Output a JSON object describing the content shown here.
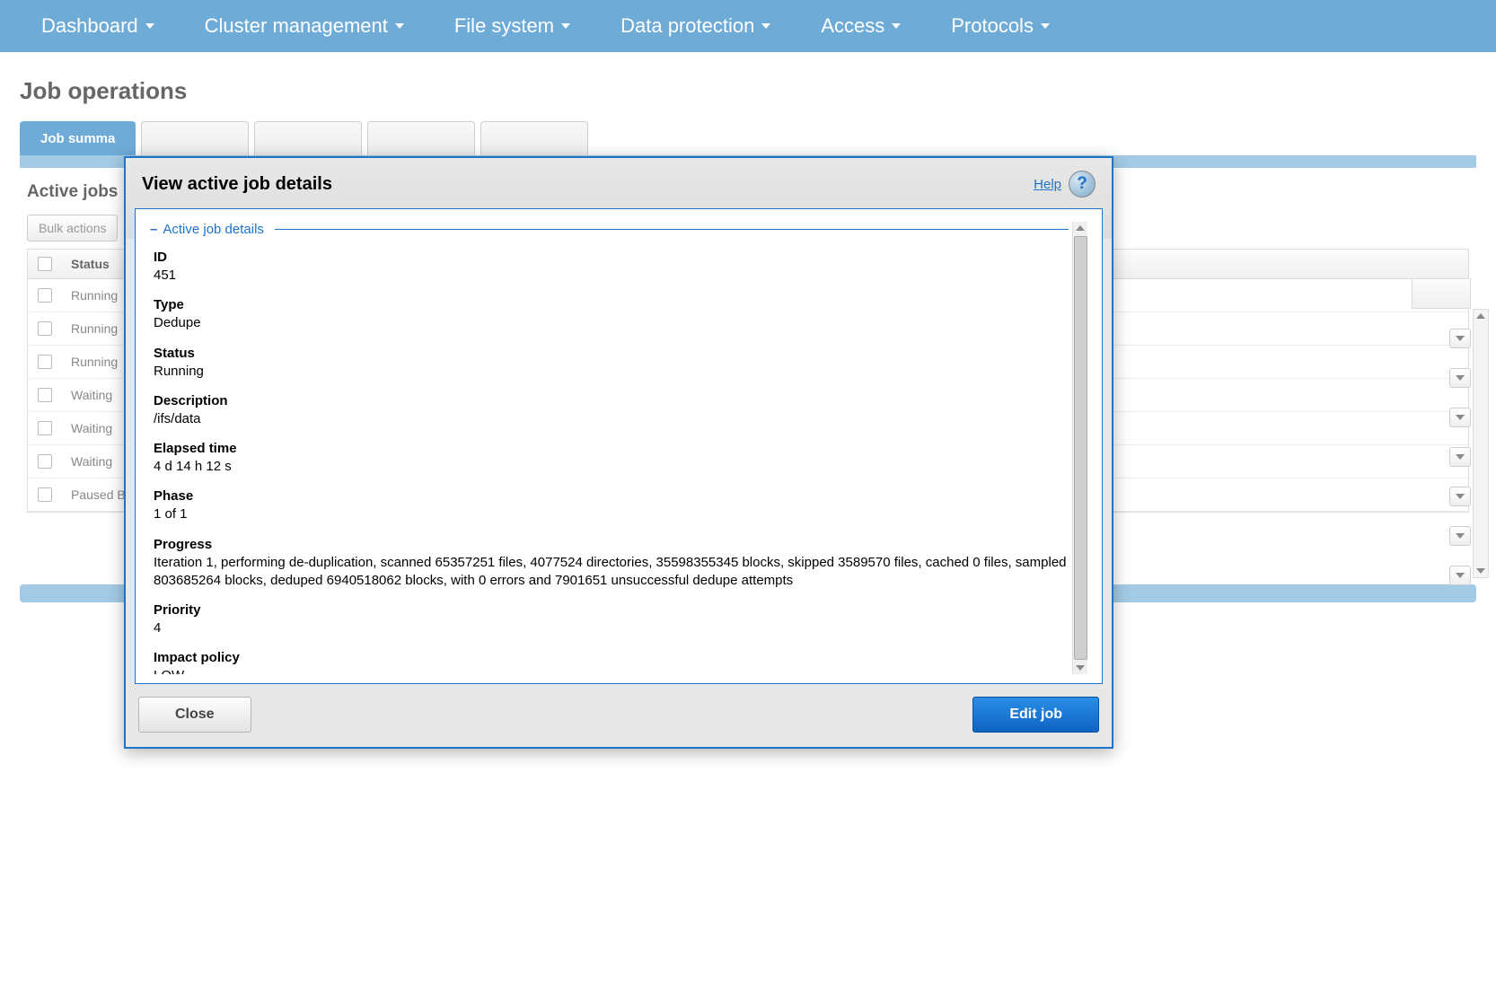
{
  "nav": {
    "items": [
      {
        "label": "Dashboard"
      },
      {
        "label": "Cluster management"
      },
      {
        "label": "File system"
      },
      {
        "label": "Data protection"
      },
      {
        "label": "Access"
      },
      {
        "label": "Protocols"
      }
    ]
  },
  "page": {
    "title": "Job operations"
  },
  "tabs": {
    "active_label": "Job summa",
    "others": [
      "",
      "",
      "",
      ""
    ]
  },
  "section": {
    "title": "Active jobs",
    "bulk_label": "Bulk actions",
    "col_status": "Status",
    "rows": [
      {
        "status": "Running"
      },
      {
        "status": "Running"
      },
      {
        "status": "Running"
      },
      {
        "status": "Waiting"
      },
      {
        "status": "Waiting"
      },
      {
        "status": "Waiting"
      },
      {
        "status": "Paused B"
      }
    ]
  },
  "modal": {
    "title": "View active job details",
    "help_label": "Help",
    "fieldset_title": "Active job details",
    "details": {
      "id": {
        "label": "ID",
        "value": "451"
      },
      "type": {
        "label": "Type",
        "value": "Dedupe"
      },
      "status": {
        "label": "Status",
        "value": "Running"
      },
      "description": {
        "label": "Description",
        "value": "/ifs/data"
      },
      "elapsed": {
        "label": "Elapsed time",
        "value": "4 d 14 h 12 s"
      },
      "phase": {
        "label": "Phase",
        "value": "1 of 1"
      },
      "progress": {
        "label": "Progress",
        "value": "Iteration 1, performing de-duplication, scanned 65357251 files, 4077524 directories, 35598355345 blocks, skipped 3589570 files, cached 0 files, sampled 803685264 blocks, deduped 6940518062 blocks, with 0 errors and 7901651 unsuccessful dedupe attempts"
      },
      "priority": {
        "label": "Priority",
        "value": "4"
      },
      "impact": {
        "label": "Impact policy",
        "value": "LOW"
      }
    },
    "close_label": "Close",
    "edit_label": "Edit job"
  }
}
